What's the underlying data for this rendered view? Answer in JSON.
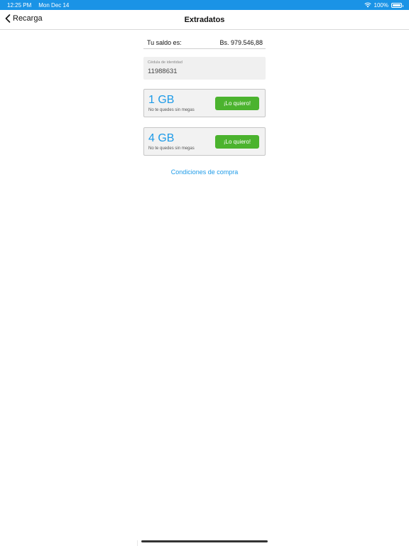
{
  "status_bar": {
    "time": "12:25 PM",
    "date": "Mon Dec 14",
    "battery": "100%"
  },
  "nav": {
    "back_label": "Recarga",
    "title": "Extradatos"
  },
  "balance": {
    "label": "Tu saldo es:",
    "value": "Bs. 979.546,88"
  },
  "id_field": {
    "label": "Cédula de identidad",
    "value": "11988631"
  },
  "plans": [
    {
      "size": "1 GB",
      "description": "No te quedes sin megas",
      "button_label": "¡Lo quiero!"
    },
    {
      "size": "4 GB",
      "description": "No te quedes sin megas",
      "button_label": "¡Lo quiero!"
    }
  ],
  "terms_link": "Condiciones de compra",
  "colors": {
    "status_bar": "#1a93e6",
    "accent_blue": "#1e9be8",
    "button_green": "#4bb32e"
  }
}
